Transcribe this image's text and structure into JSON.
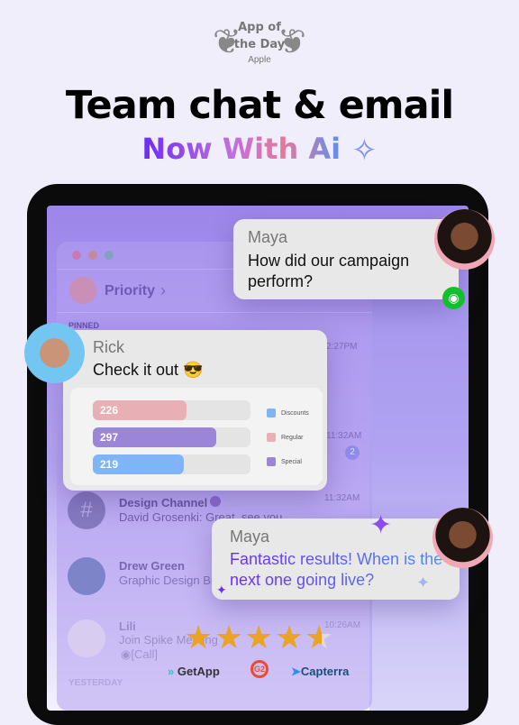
{
  "award": {
    "line1": "App of",
    "line2": "the Day",
    "line3": "Apple"
  },
  "headline": "Team chat & email",
  "subheadline": "Now With Ai",
  "app": {
    "list_header": "Priority",
    "pinned_label": "PINNED",
    "yesterday_label": "YESTERDAY",
    "conversations": [
      {
        "title": "Design Channel",
        "preview": "David Grosenki: Great, see you",
        "time": "11:32AM"
      },
      {
        "title": "Drew Green",
        "preview": "Graphic Design Br",
        "time": ""
      },
      {
        "title": "Lili",
        "preview": "Join Spike Meeting",
        "extra": "[Call]",
        "time": "10:26AM"
      }
    ],
    "times": [
      "2:27PM",
      "11:32AM"
    ],
    "unread_badge": "2"
  },
  "bubbles": {
    "maya1": {
      "name": "Maya",
      "message": "How did our campaign perform?"
    },
    "rick": {
      "name": "Rick",
      "message": "Check it out 😎"
    },
    "maya2": {
      "name": "Maya",
      "message": "Fantastic results! When is the next one going live?"
    }
  },
  "chart_data": {
    "type": "bar",
    "orientation": "horizontal",
    "values": [
      226,
      297,
      219
    ],
    "bar_colors": [
      "#e8b0b4",
      "#9a85d9",
      "#7fb5f7"
    ],
    "legend": [
      {
        "name": "Discounts",
        "color": "#7fb5f7"
      },
      {
        "name": "Regular",
        "color": "#e8b0b4"
      },
      {
        "name": "Special",
        "color": "#9a85d9"
      }
    ]
  },
  "rating": {
    "stars": 4.5,
    "max": 5
  },
  "brands": [
    "GetApp",
    "G2",
    "Capterra"
  ],
  "colors": {
    "eye_badge": "#12c02e",
    "star": "#eba325"
  }
}
